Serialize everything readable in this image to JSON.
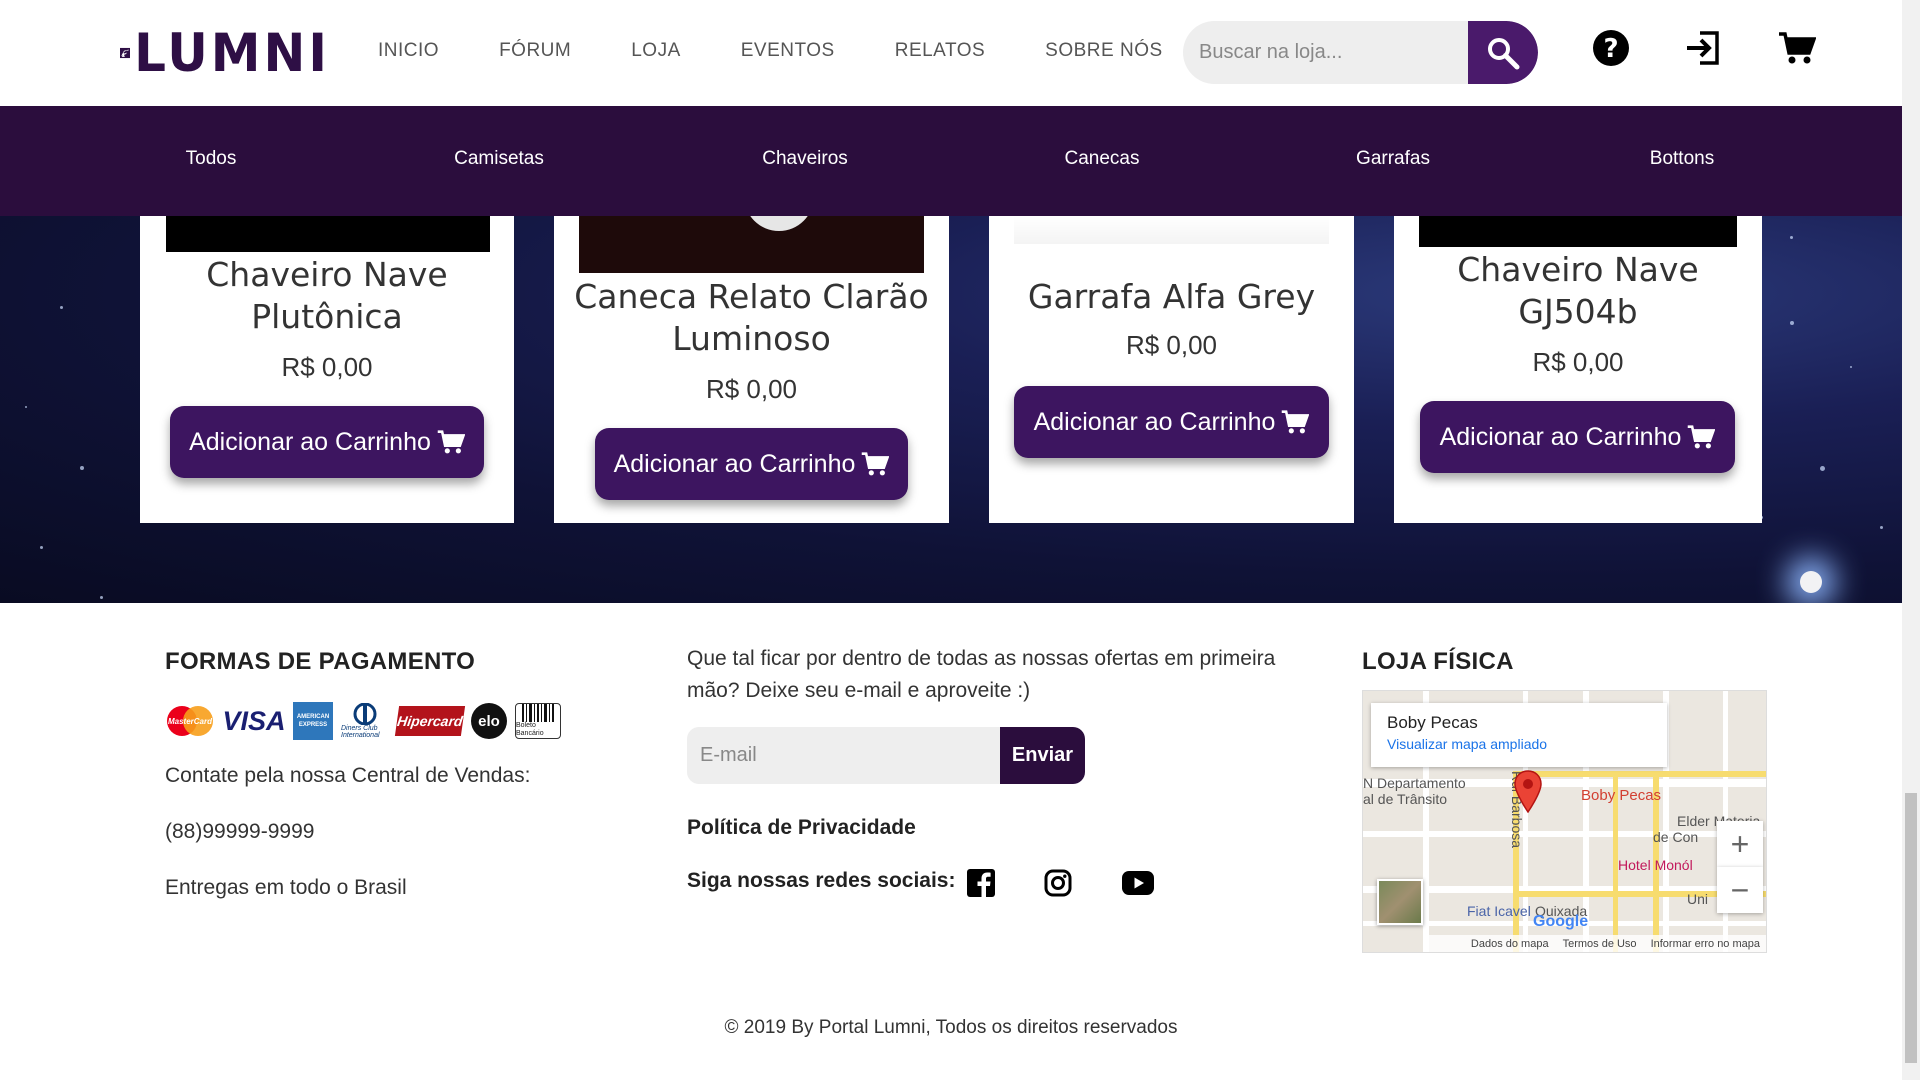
{
  "header": {
    "logo_text": "LUMNI",
    "nav": [
      "INICIO",
      "FÓRUM",
      "LOJA",
      "EVENTOS",
      "RELATOS",
      "SOBRE NÓS"
    ],
    "search_placeholder": "Buscar na loja...",
    "icons": [
      "search-icon",
      "help-icon",
      "login-icon",
      "cart-icon"
    ]
  },
  "categories": [
    "Todos",
    "Camisetas",
    "Chaveiros",
    "Canecas",
    "Garrafas",
    "Bottons"
  ],
  "products": [
    {
      "name": "Chaveiro Nave Plutônica",
      "price": "R$ 0,00",
      "button": "Adicionar ao Carrinho"
    },
    {
      "name": "Caneca Relato Clarão Luminoso",
      "price": "R$ 0,00",
      "button": "Adicionar ao Carrinho"
    },
    {
      "name": "Garrafa Alfa Grey",
      "price": "R$ 0,00",
      "button": "Adicionar ao Carrinho"
    },
    {
      "name": "Chaveiro Nave GJ504b",
      "price": "R$ 0,00",
      "button": "Adicionar ao Carrinho"
    }
  ],
  "footer": {
    "payment_title": "FORMAS DE PAGAMENTO",
    "payment_methods": [
      "MasterCard",
      "VISA",
      "AMERICAN EXPRESS",
      "Diners Club International",
      "Hipercard",
      "elo",
      "Boleto Bancário"
    ],
    "contact_label": "Contate pela nossa Central de Vendas:",
    "phone": "(88)99999-9999",
    "delivery": "Entregas em todo o Brasil",
    "newsletter_text": "Que tal ficar por dentro de todas as nossas ofertas em primeira mão? Deixe seu e-mail e aproveite :)",
    "email_placeholder": "E-mail",
    "send_label": "Enviar",
    "privacy": "Política de Privacidade",
    "social_label": "Siga nossas redes sociais:",
    "social_icons": [
      "facebook-icon",
      "instagram-icon",
      "youtube-icon"
    ],
    "store_title": "LOJA FÍSICA",
    "copyright": "© 2019 By Portal Lumni, Todos os direitos reservados"
  },
  "map": {
    "place_name": "Boby Pecas",
    "view_larger": "Visualizar mapa ampliado",
    "labels": [
      "N Departamento",
      "al de Trânsito",
      "Rui Barbosa",
      "Boby Pecas",
      "Elder Materia",
      "de Con",
      "Hotel Monól",
      "Fiat Icavel",
      "Quixada",
      "Uni"
    ],
    "brand": "Google",
    "footer_links": [
      "Dados do mapa",
      "Termos de Uso",
      "Informar erro no mapa"
    ],
    "zoom_in": "+",
    "zoom_out": "−"
  }
}
